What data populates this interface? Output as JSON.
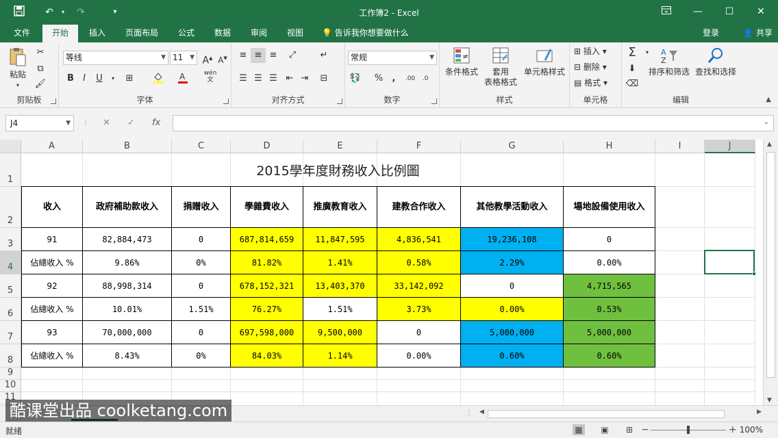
{
  "window": {
    "title": "工作簿2 - Excel",
    "quick_access": {
      "save": "save-icon",
      "undo": "undo-icon",
      "redo": "redo-icon",
      "customize": "customize-icon"
    },
    "controls": {
      "ribbon_display": "ribbon-display-icon",
      "minimize": "minimize-icon",
      "maximize": "maximize-icon",
      "close": "close-icon"
    }
  },
  "menu": {
    "tabs": [
      "文件",
      "开始",
      "插入",
      "页面布局",
      "公式",
      "数据",
      "审阅",
      "视图"
    ],
    "active_tab": "开始",
    "tell_me": "告诉我你想要做什么",
    "login": "登录",
    "share": "共享"
  },
  "ribbon": {
    "clipboard": {
      "label": "剪贴板",
      "paste": "粘贴"
    },
    "font": {
      "label": "字体",
      "font_name": "等线",
      "font_size": "11",
      "bold": "B",
      "italic": "I",
      "underline": "U",
      "wen": "wén"
    },
    "alignment": {
      "label": "对齐方式"
    },
    "number": {
      "label": "数字",
      "format": "常规",
      "percent": "%",
      "comma": ","
    },
    "styles": {
      "label": "样式",
      "conditional": "条件格式",
      "table_format_1": "套用",
      "table_format_2": "表格格式",
      "cell_styles": "单元格样式"
    },
    "cells": {
      "label": "单元格",
      "insert": "插入",
      "delete": "删除",
      "format": "格式"
    },
    "editing": {
      "label": "编辑",
      "sort_filter": "排序和筛选",
      "find_select": "查找和选择"
    }
  },
  "formula_bar": {
    "name_box": "J4",
    "cancel": "✕",
    "enter": "✓",
    "fx": "fx",
    "formula": ""
  },
  "grid": {
    "columns": [
      "A",
      "B",
      "C",
      "D",
      "E",
      "F",
      "G",
      "H",
      "I",
      "J"
    ],
    "selected_column": "J",
    "rows": [
      "1",
      "2",
      "3",
      "4",
      "5",
      "6",
      "7",
      "8",
      "9",
      "10",
      "11"
    ],
    "title": "2015學年度財務收入比例圖",
    "headers": [
      "收入",
      "政府補助款收入",
      "捐贈收入",
      "學雜費收入",
      "推廣教育收入",
      "建教合作收入",
      "其他教學活動收入",
      "場地設備使用收入"
    ],
    "data_rows": [
      {
        "cells": [
          "91",
          "82,884,473",
          "0",
          "687,814,659",
          "11,847,595",
          "4,836,541",
          "19,236,108",
          "0"
        ],
        "fills": [
          "#ffffff",
          "#ffffff",
          "#ffffff",
          "#ffff00",
          "#ffff00",
          "#ffff00",
          "#00b0f0",
          "#ffffff"
        ]
      },
      {
        "cells": [
          "佔總收入 %",
          "9.86%",
          "0%",
          "81.82%",
          "1.41%",
          "0.58%",
          "2.29%",
          "0.00%"
        ],
        "fills": [
          "#ffffff",
          "#ffffff",
          "#ffffff",
          "#ffff00",
          "#ffff00",
          "#ffff00",
          "#00b0f0",
          "#ffffff"
        ]
      },
      {
        "cells": [
          "92",
          "88,998,314",
          "0",
          "678,152,321",
          "13,403,370",
          "33,142,092",
          "0",
          "4,715,565"
        ],
        "fills": [
          "#ffffff",
          "#ffffff",
          "#ffffff",
          "#ffff00",
          "#ffff00",
          "#ffff00",
          "#ffffff",
          "#70c040"
        ]
      },
      {
        "cells": [
          "佔總收入 %",
          "10.01%",
          "1.51%",
          "76.27%",
          "1.51%",
          "3.73%",
          "0.00%",
          "0.53%"
        ],
        "fills": [
          "#ffffff",
          "#ffffff",
          "#ffffff",
          "#ffff00",
          "#ffffff",
          "#ffff00",
          "#ffff00",
          "#70c040"
        ]
      },
      {
        "cells": [
          "93",
          "70,000,000",
          "0",
          "697,598,000",
          "9,500,000",
          "0",
          "5,000,000",
          "5,000,000"
        ],
        "fills": [
          "#ffffff",
          "#ffffff",
          "#ffffff",
          "#ffff00",
          "#ffff00",
          "#ffffff",
          "#00b0f0",
          "#70c040"
        ]
      },
      {
        "cells": [
          "佔總收入 %",
          "8.43%",
          "0%",
          "84.03%",
          "1.14%",
          "0.00%",
          "0.60%",
          "0.60%"
        ],
        "fills": [
          "#ffffff",
          "#ffffff",
          "#ffffff",
          "#ffff00",
          "#ffff00",
          "#ffffff",
          "#00b0f0",
          "#70c040"
        ]
      }
    ]
  },
  "status_bar": {
    "ready": "就绪",
    "zoom": "100%",
    "zoom_out": "−",
    "zoom_in": "+"
  },
  "watermark": "酷课堂出品 coolketang.com",
  "colors": {
    "excel_green": "#217346",
    "yellow": "#ffff00",
    "blue": "#00b0f0",
    "green": "#70c040"
  }
}
